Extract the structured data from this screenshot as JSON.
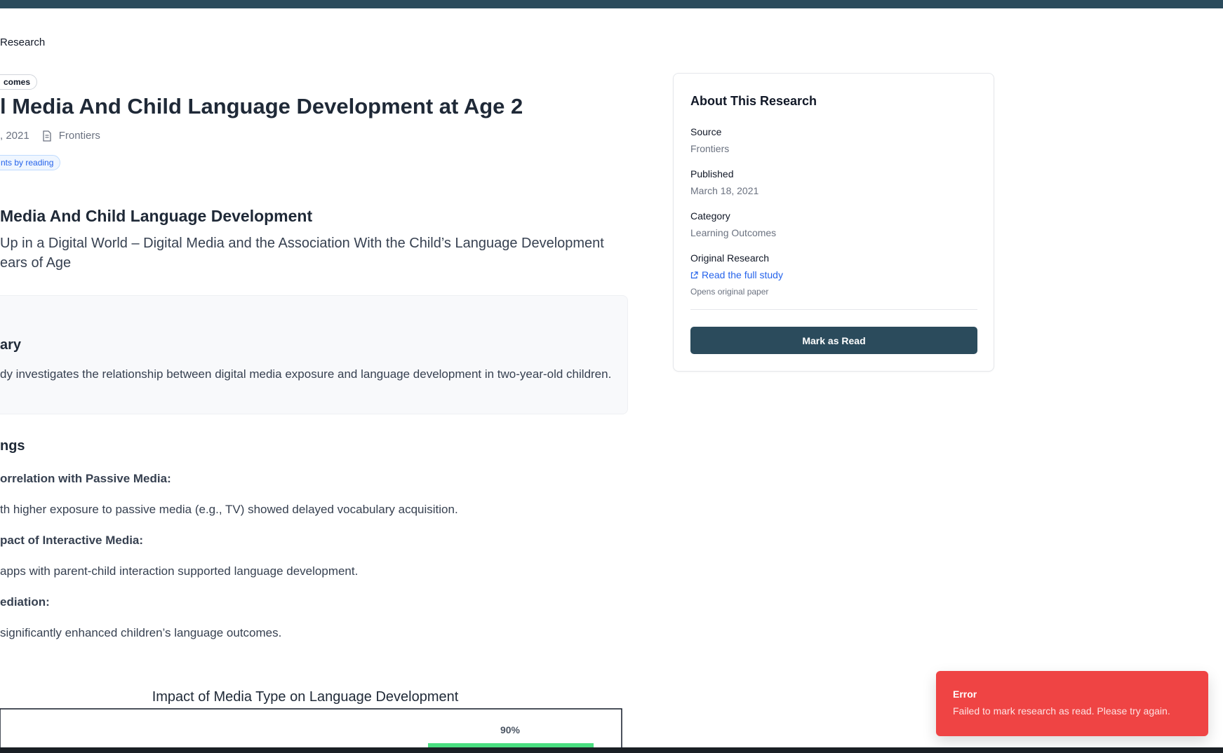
{
  "breadcrumb": {
    "current": "Research"
  },
  "article": {
    "category_badge": "comes",
    "title": "l Media And Child Language Development at Age 2",
    "date": ", 2021",
    "source": "Frontiers",
    "tag": "nts by reading",
    "heading": "Media And Child Language Development",
    "subtitle_line1": "Up in a Digital World – Digital Media and the Association With the Child’s Language Development",
    "subtitle_line2": "ears of Age"
  },
  "summary": {
    "heading": "ary",
    "text": "dy investigates the relationship between digital media exposure and language development in two-year-old children."
  },
  "findings": {
    "heading": "ngs",
    "items": [
      {
        "title": "orrelation with Passive Media:",
        "text": "th higher exposure to passive media (e.g., TV) showed delayed vocabulary acquisition."
      },
      {
        "title": "pact of Interactive Media:",
        "text": " apps with parent-child interaction supported language development."
      },
      {
        "title": "ediation:",
        "text": "significantly enhanced children’s language outcomes."
      }
    ]
  },
  "chart_data": {
    "type": "bar",
    "title": "Impact of Media Type on Language Development",
    "data_labels": [
      "90%"
    ],
    "values": [
      90
    ],
    "colors": {
      "bar": "#4ade80"
    }
  },
  "sidebar": {
    "title": "About This Research",
    "source_label": "Source",
    "source_value": "Frontiers",
    "published_label": "Published",
    "published_value": "March 18, 2021",
    "category_label": "Category",
    "category_value": "Learning Outcomes",
    "original_label": "Original Research",
    "link_text": "Read the full study",
    "link_note": "Opens original paper",
    "button_label": "Mark as Read"
  },
  "toast": {
    "title": "Error",
    "message": "Failed to mark research as read. Please try again."
  },
  "colors": {
    "primary": "#2b4b5c",
    "link": "#2563eb",
    "error": "#ef4444"
  }
}
